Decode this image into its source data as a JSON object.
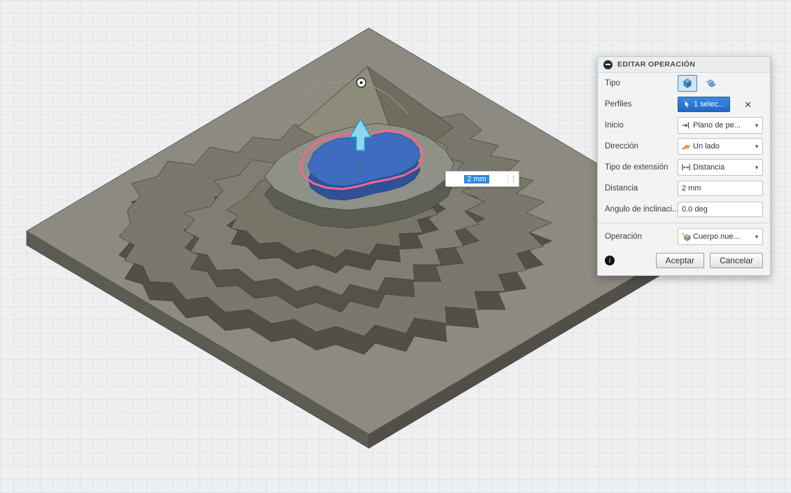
{
  "viewport": {
    "distance_input": {
      "value": "2 mm",
      "menu_icon": "kebab-menu-icon"
    },
    "manipulator": {
      "icon": "extrude-arrow-manipulator",
      "color": "#8ed6f2"
    },
    "selection_outline_color": "#f2688e",
    "selected_body_color": "#3e6dbf"
  },
  "dialog": {
    "title": "EDITAR OPERACIÓN",
    "header_icon": "dialog-handle-icon",
    "fields": {
      "tipo": {
        "label": "Tipo",
        "options": [
          {
            "icon": "extrude-solid-icon",
            "selected": true
          },
          {
            "icon": "extrude-thin-icon",
            "selected": false
          }
        ]
      },
      "perfiles": {
        "label": "Perfiles",
        "value": "1 selec...",
        "icon": "cursor-arrow-icon",
        "clear_icon": "close-icon"
      },
      "inicio": {
        "label": "Inicio",
        "value": "Plano de pe...",
        "icon": "start-plane-icon"
      },
      "direccion": {
        "label": "Dirección",
        "value": "Un lado",
        "icon": "direction-icon"
      },
      "tipo_extension": {
        "label": "Tipo de extensión",
        "value": "Distancia",
        "icon": "extent-distance-icon"
      },
      "distancia": {
        "label": "Distancia",
        "value": "2 mm"
      },
      "angulo": {
        "label": "Ángulo de inclinaci...",
        "value": "0.0 deg"
      },
      "operacion": {
        "label": "Operación",
        "value": "Cuerpo nue...",
        "icon": "new-body-icon"
      }
    },
    "footer": {
      "info_icon": "info-icon",
      "accept_label": "Aceptar",
      "cancel_label": "Cancelar"
    }
  },
  "glyphs": {
    "chevron": "▾",
    "kebab": "⋮",
    "close": "✕",
    "info": "i"
  },
  "colors": {
    "accent_blue": "#2f7bd9",
    "selection_pink": "#f2688e",
    "grid_line": "#e0e3e7",
    "background": "#edeff1"
  }
}
